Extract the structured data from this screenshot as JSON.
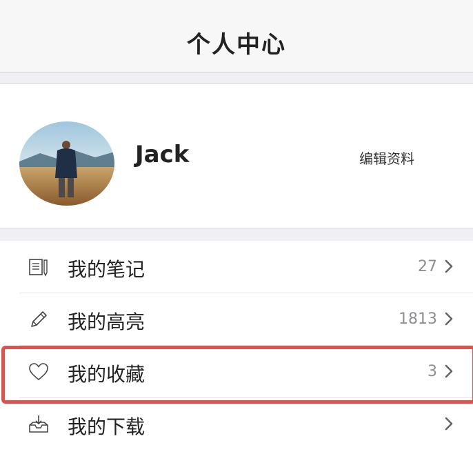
{
  "navbar": {
    "title": "个人中心"
  },
  "profile": {
    "username": "Jack",
    "edit_label": "编辑资料"
  },
  "menu": {
    "items": [
      {
        "label": "我的笔记",
        "count": "27",
        "icon": "notes-icon"
      },
      {
        "label": "我的高亮",
        "count": "1813",
        "icon": "pencil-icon"
      },
      {
        "label": "我的收藏",
        "count": "3",
        "icon": "heart-icon"
      },
      {
        "label": "我的下载",
        "count": "",
        "icon": "download-tray-icon"
      }
    ]
  },
  "colors": {
    "highlight_border": "#d9534f",
    "navbar_bg": "#f7f7f7",
    "separator_bg": "#efeff4",
    "secondary_text": "#8e8e93"
  }
}
